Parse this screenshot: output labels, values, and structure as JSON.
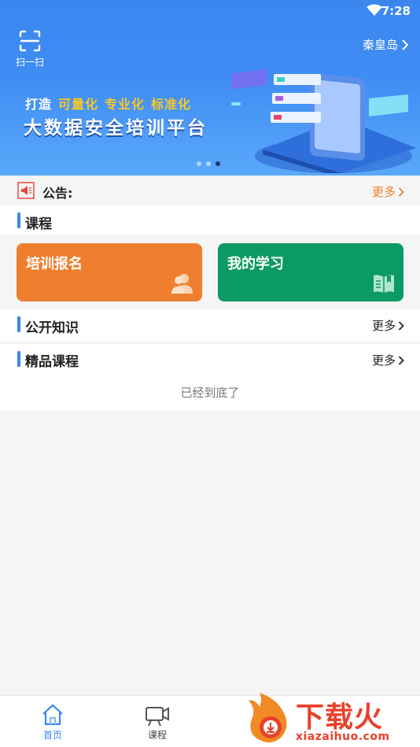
{
  "status_bar": {
    "time": "7:28"
  },
  "header": {
    "scan_label": "扫一扫",
    "city": "秦皇岛"
  },
  "banner": {
    "slogan_prefix": "打造",
    "slogan_highlights": [
      "可量化",
      "专业化",
      "标准化"
    ],
    "headline": "大数据安全培训平台",
    "carousel_count": 3,
    "carousel_active_index": 2
  },
  "notice": {
    "label": "公告:",
    "more": "更多"
  },
  "courses": {
    "title": "课程",
    "cards": [
      {
        "title": "培训报名",
        "color": "#ef7f2f",
        "icon": "people-icon"
      },
      {
        "title": "我的学习",
        "color": "#0c9a64",
        "icon": "book-icon"
      }
    ]
  },
  "public_knowledge": {
    "title": "公开知识",
    "more": "更多"
  },
  "premium_courses": {
    "title": "精品课程",
    "more": "更多"
  },
  "end_text": "已经到底了",
  "tabbar": {
    "tabs": [
      {
        "label": "首页",
        "icon": "home-icon",
        "active": true
      },
      {
        "label": "课程",
        "icon": "video-icon",
        "active": false
      }
    ]
  },
  "watermark": {
    "text": "下载火",
    "url": "xiazaihuo.com"
  },
  "colors": {
    "primary": "#3b86ef",
    "orange": "#ef7f2b",
    "green": "#0c9a64",
    "highlight": "#f7c826"
  }
}
